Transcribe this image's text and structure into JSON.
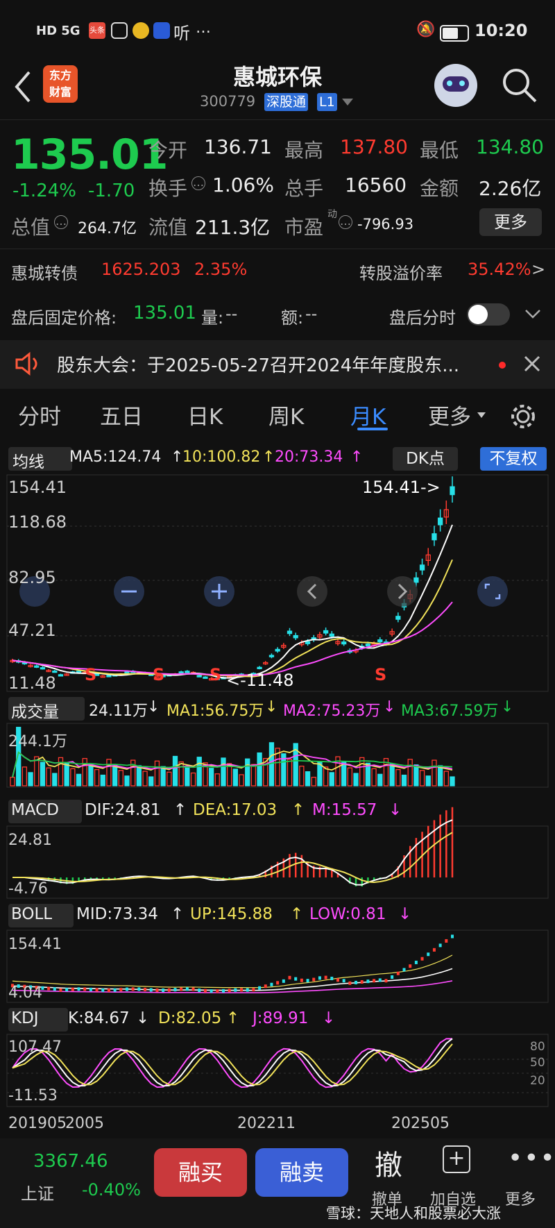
{
  "status_bar": {
    "left": "HD 5G",
    "apps": [
      "头条",
      "微博",
      "听",
      "…"
    ],
    "time": "10:20"
  },
  "header": {
    "title": "惠城环保",
    "code": "300779",
    "market": "深股通",
    "level": "L1",
    "logo_line1": "东方",
    "logo_line2": "财富"
  },
  "quote": {
    "price": "135.01",
    "change_pct": "-1.24%",
    "change": "-1.70",
    "open_label": "今开",
    "open": "136.71",
    "high_label": "最高",
    "high": "137.80",
    "low_label": "最低",
    "low": "134.80",
    "turnover_label": "换手",
    "turnover": "1.06%",
    "volume_label": "总手",
    "volume": "16560",
    "amount_label": "金额",
    "amount": "2.26亿",
    "mktcap_label": "总值",
    "mktcap": "264.7亿",
    "float_label": "流值",
    "float_cap": "211.3亿",
    "pe_label": "市盈",
    "pe_sup": "动",
    "pe": "-796.93",
    "more_btn": "更多"
  },
  "convertible": {
    "name": "惠城转债",
    "price": "1625.203",
    "pct": "2.35%",
    "premium_label": "转股溢价率",
    "premium": "35.42%",
    "arrow": ">"
  },
  "after_hours": {
    "label": "盘后固定价格:",
    "price": "135.01",
    "vol_label": "量:",
    "vol": "--",
    "amt_label": "额:",
    "amt": "--",
    "toggle_label": "盘后分时"
  },
  "notice": {
    "text": "股东大会：于2025-05-27召开2024年年度股东..."
  },
  "tabs": [
    "分时",
    "五日",
    "日K",
    "周K",
    "月K",
    "更多"
  ],
  "active_tab": "月K",
  "ma_bar": {
    "label": "均线",
    "ma5": "MA5:124.74",
    "ma10": "10:100.82",
    "ma20": "20:73.34",
    "dk_btn": "DK点",
    "fq_btn": "不复权"
  },
  "kline": {
    "y_top": "154.41",
    "y_2": "118.68",
    "y_3": "82.95",
    "y_4": "47.21",
    "y_bottom": "11.48",
    "max_annot": "154.41->",
    "min_annot": "<-11.48",
    "s_marks": [
      "S",
      "S",
      "S",
      "S"
    ]
  },
  "volume_bar": {
    "label": "成交量",
    "vol": "24.11万",
    "ma1": "MA1:56.75万",
    "ma2": "MA2:75.23万",
    "ma3": "MA3:67.59万",
    "y_top": "244.1万"
  },
  "macd_bar": {
    "label": "MACD",
    "dif": "DIF:24.81",
    "dea": "DEA:17.03",
    "m": "M:15.57",
    "y_top": "24.81",
    "y_bottom": "-4.76"
  },
  "boll_bar": {
    "label": "BOLL",
    "mid": "MID:73.34",
    "up": "UP:145.88",
    "low": "LOW:0.81",
    "y_top": "154.41",
    "y_bottom": "4.04"
  },
  "kdj_bar": {
    "label": "KDJ",
    "k": "K:84.67",
    "d": "D:82.05",
    "j": "J:89.91",
    "y_top": "107.47",
    "y_bottom": "-11.53",
    "lvl80": "80",
    "lvl50": "50",
    "lvl20": "20"
  },
  "x_axis": [
    "201905",
    "2005",
    "202211",
    "202505"
  ],
  "bottom_bar": {
    "index_value": "3367.46",
    "index_name": "上证",
    "index_pct": "-0.40%",
    "buy": "融买",
    "sell": "融卖",
    "cancel_icon": "撤",
    "cancel": "撤单",
    "add_icon": "+",
    "add": "加自选",
    "more": "更多",
    "watermark": "雪球：天地人和股票必大涨"
  },
  "colors": {
    "up": "#ff3b30",
    "down": "#1ecb4f",
    "accent": "#3b8cff",
    "buy": "#c9393c",
    "sell": "#3a5fd6"
  }
}
